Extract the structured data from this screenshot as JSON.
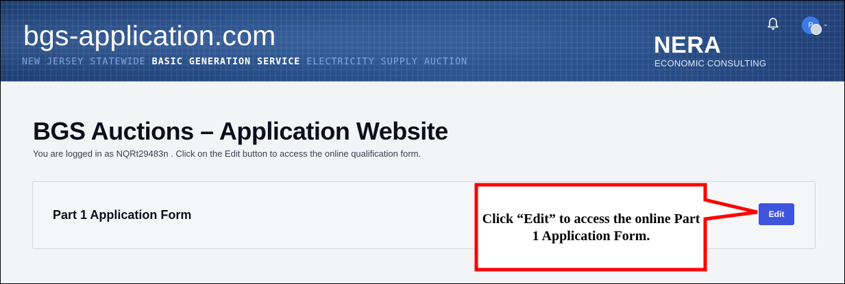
{
  "header": {
    "site_title": "bgs-application.com",
    "subtitle_part1": "NEW JERSEY STATEWIDE ",
    "subtitle_part2": "BASIC GENERATION SERVICE",
    "subtitle_part3": " ELECTRICITY SUPPLY AUCTION",
    "brand_name": "NERA",
    "brand_sub": "ECONOMIC CONSULTING",
    "notification_icon": "bell-icon",
    "avatar_initials": "P",
    "user_menu_icon": "chevron-down-icon"
  },
  "main": {
    "title": "BGS Auctions – Application Website",
    "description": "You are logged in as NQRt29483n . Click on the Edit button to access the online qualification form."
  },
  "card": {
    "title": "Part 1 Application Form",
    "edit_label": "Edit"
  },
  "callout": {
    "text": "Click “Edit” to access the online Part 1 Application Form."
  },
  "colors": {
    "header_bg": "#254d88",
    "edit_button": "#3f54dc",
    "callout_border": "#ff0000"
  }
}
